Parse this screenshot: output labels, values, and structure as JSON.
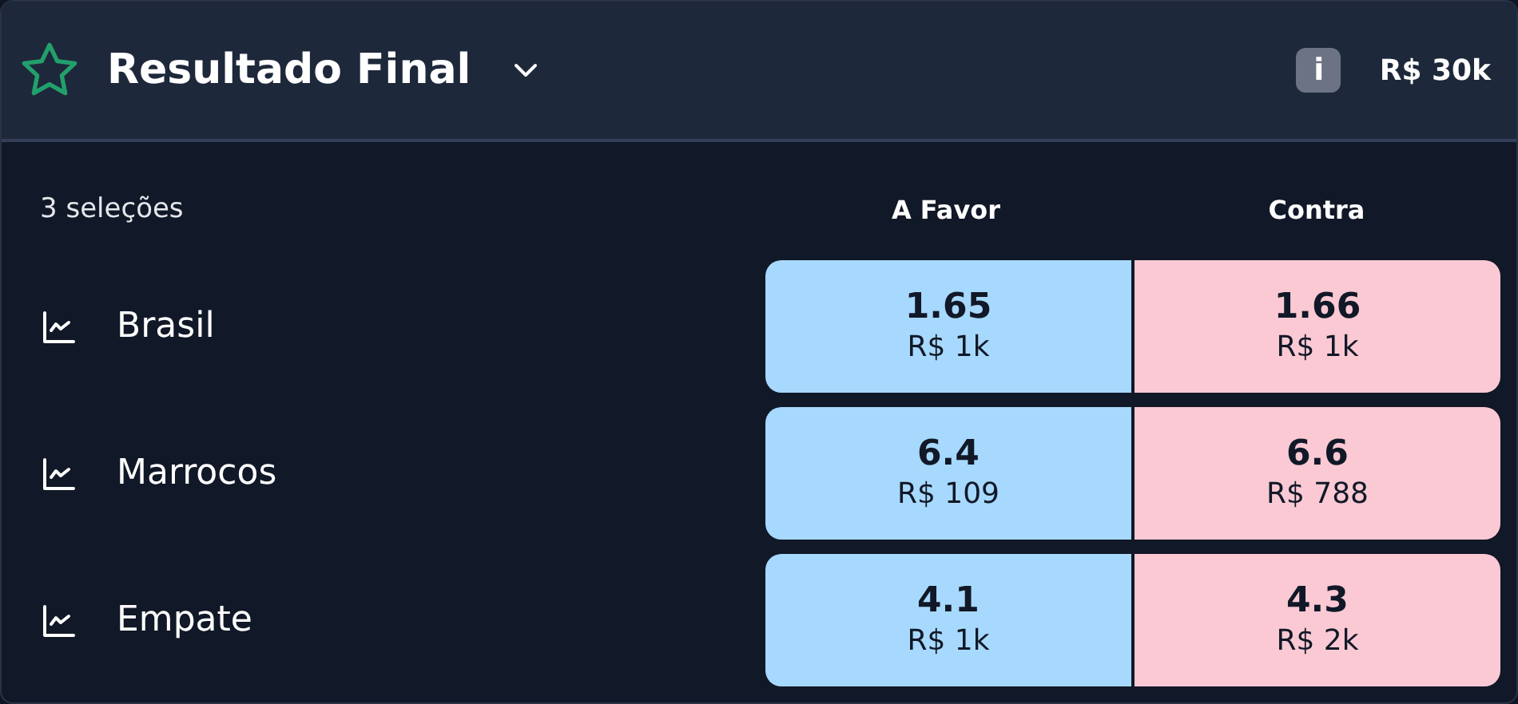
{
  "header": {
    "title": "Resultado Final",
    "info": "i",
    "matched": "R$ 30k"
  },
  "market": {
    "selections_count": "3 seleções",
    "columns": [
      "A Favor",
      "Contra"
    ],
    "runners": [
      {
        "name": "Brasil",
        "back": {
          "odds": "1.65",
          "amount": "R$ 1k"
        },
        "lay": {
          "odds": "1.66",
          "amount": "R$ 1k"
        }
      },
      {
        "name": "Marrocos",
        "back": {
          "odds": "6.4",
          "amount": "R$ 109"
        },
        "lay": {
          "odds": "6.6",
          "amount": "R$ 788"
        }
      },
      {
        "name": "Empate",
        "back": {
          "odds": "4.1",
          "amount": "R$ 1k"
        },
        "lay": {
          "odds": "4.3",
          "amount": "R$ 2k"
        }
      }
    ]
  }
}
